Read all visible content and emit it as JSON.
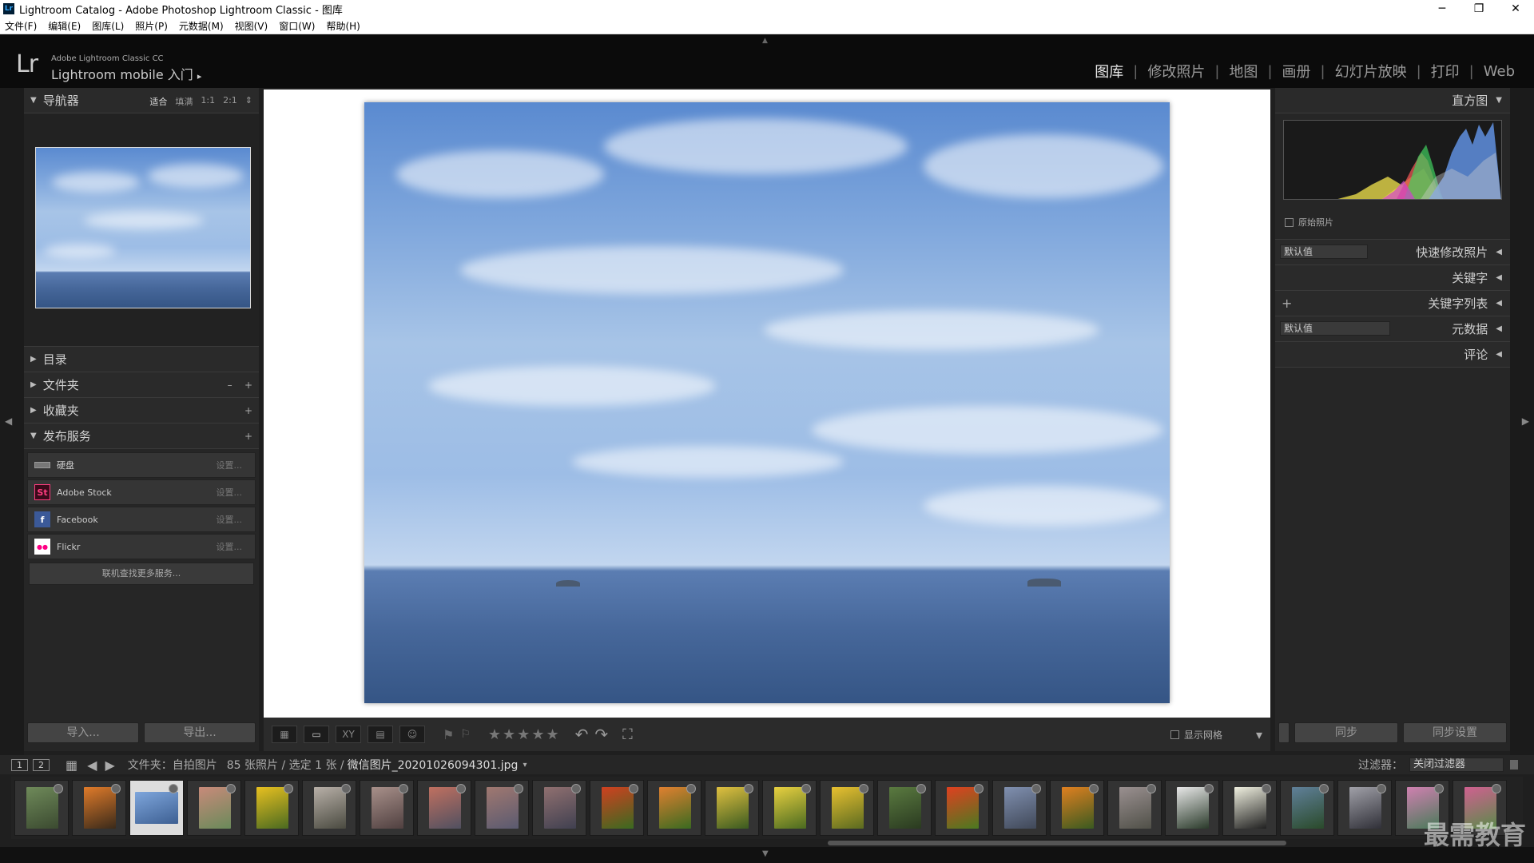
{
  "window": {
    "title": "Lightroom Catalog - Adobe Photoshop Lightroom Classic - 图库",
    "minimize": "─",
    "restore": "❐",
    "close": "✕"
  },
  "menu": [
    "文件(F)",
    "编辑(E)",
    "图库(L)",
    "照片(P)",
    "元数据(M)",
    "视图(V)",
    "窗口(W)",
    "帮助(H)"
  ],
  "identity": {
    "logo": "Lr",
    "product": "Adobe Lightroom Classic CC",
    "mobile": "Lightroom mobile 入门",
    "arrow": "▸"
  },
  "modules": [
    {
      "label": "图库",
      "active": true
    },
    {
      "label": "修改照片",
      "active": false
    },
    {
      "label": "地图",
      "active": false
    },
    {
      "label": "画册",
      "active": false
    },
    {
      "label": "幻灯片放映",
      "active": false
    },
    {
      "label": "打印",
      "active": false
    },
    {
      "label": "Web",
      "active": false
    }
  ],
  "left": {
    "navigator": {
      "title": "导航器",
      "zoom": [
        "适合",
        "填满",
        "1:1",
        "2:1"
      ],
      "zoom_arrow": "⇕"
    },
    "catalog": "目录",
    "folders": "文件夹",
    "collections": "收藏夹",
    "publish": "发布服务",
    "minus": "–",
    "plus": "+",
    "services": [
      {
        "name": "硬盘",
        "set": "设置...",
        "icon": "hdd-icon",
        "color": "#888888"
      },
      {
        "name": "Adobe Stock",
        "set": "设置...",
        "icon": "adobe-stock-icon",
        "color": "#e0115f",
        "glyph": "St"
      },
      {
        "name": "Facebook",
        "set": "设置...",
        "icon": "facebook-icon",
        "color": "#3b5998",
        "glyph": "f"
      },
      {
        "name": "Flickr",
        "set": "设置...",
        "icon": "flickr-icon",
        "color": "#ff0084",
        "glyph": "●●"
      }
    ],
    "more": "联机查找更多服务...",
    "import": "导入...",
    "export": "导出..."
  },
  "toolbar": {
    "stars": "★★★★★",
    "show_grid": "显示网格",
    "dropdown": "▾"
  },
  "right": {
    "histogram": "直方图",
    "original": "原始照片",
    "quick": "快速修改照片",
    "quick_preset": "默认值",
    "keywords": "关键字",
    "keyword_list": "关键字列表",
    "metadata": "元数据",
    "meta_preset": "默认值",
    "comments": "评论",
    "sync": "同步",
    "sync_settings": "同步设置"
  },
  "filmbar": {
    "view1": "1",
    "view2": "2",
    "path_prefix": "文件夹：自拍图片",
    "count": "85 张照片 / 选定 1 张 /",
    "filename": "微信图片_20201026094301.jpg",
    "filter_label": "过滤器：",
    "filter_value": "关闭过滤器"
  },
  "watermark": "最需教育",
  "colors": {
    "accent": "#e6e6e6",
    "panel": "#262626",
    "sky": "#8fb3e3",
    "sea": "#3d5f92"
  },
  "thumbnails": [
    {
      "c1": "#6f8a5a",
      "c2": "#3b4a30"
    },
    {
      "c1": "#e07b2a",
      "c2": "#3a2a1a"
    },
    {
      "c1": "#7ea6dc",
      "c2": "#3d5f92",
      "selected": true
    },
    {
      "c1": "#c88a7a",
      "c2": "#6a8a5a"
    },
    {
      "c1": "#e8c020",
      "c2": "#4a6a20"
    },
    {
      "c1": "#b8b0a8",
      "c2": "#4a4a40"
    },
    {
      "c1": "#a8908a",
      "c2": "#504040"
    },
    {
      "c1": "#c07060",
      "c2": "#505060"
    },
    {
      "c1": "#a07870",
      "c2": "#5a5a70"
    },
    {
      "c1": "#907070",
      "c2": "#404050"
    },
    {
      "c1": "#d04020",
      "c2": "#3a6a20"
    },
    {
      "c1": "#e08030",
      "c2": "#3a6a20"
    },
    {
      "c1": "#e0c040",
      "c2": "#3a5a20"
    },
    {
      "c1": "#e8d040",
      "c2": "#4a6a20"
    },
    {
      "c1": "#e8c030",
      "c2": "#5a6a20"
    },
    {
      "c1": "#5a7a40",
      "c2": "#2a3a20"
    },
    {
      "c1": "#e04020",
      "c2": "#4a7a20"
    },
    {
      "c1": "#8090b0",
      "c2": "#404858"
    },
    {
      "c1": "#e08020",
      "c2": "#3a5a20"
    },
    {
      "c1": "#9a9090",
      "c2": "#505048"
    },
    {
      "c1": "#e8e8e8",
      "c2": "#2a3a2a"
    },
    {
      "c1": "#f0f0e0",
      "c2": "#202020"
    },
    {
      "c1": "#60809a",
      "c2": "#2a4a2a"
    },
    {
      "c1": "#a0a0a8",
      "c2": "#303038"
    },
    {
      "c1": "#d080b0",
      "c2": "#4a7a5a"
    },
    {
      "c1": "#d06090",
      "c2": "#5a8a4a"
    }
  ]
}
